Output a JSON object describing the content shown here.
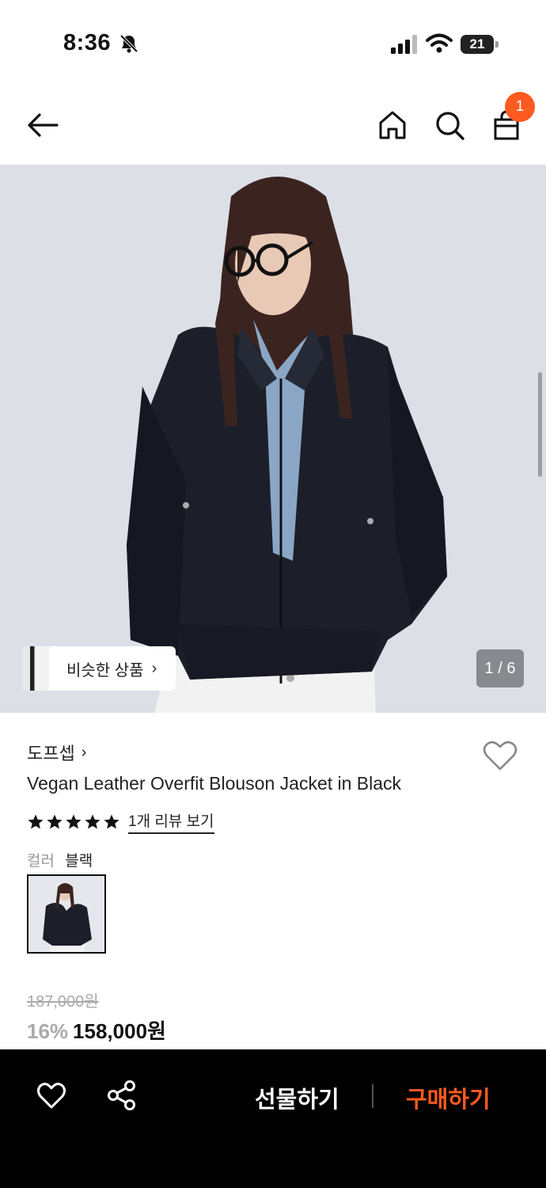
{
  "status_bar": {
    "time": "8:36",
    "battery": "21"
  },
  "nav": {
    "cart_count": "1"
  },
  "gallery": {
    "similar_label": "비슷한 상품",
    "page_counter": "1 / 6"
  },
  "product": {
    "brand": "도프셉",
    "title": "Vegan Leather Overfit Blouson Jacket in Black",
    "rating": 5,
    "review_link": "1개 리뷰 보기",
    "color_label": "컬러",
    "color_value": "블랙",
    "original_price": "187,000원",
    "discount": "16%",
    "price": "158,000원"
  },
  "bottom_bar": {
    "gift_label": "선물하기",
    "buy_label": "구매하기"
  },
  "colors": {
    "accent": "#ff5a1f",
    "bottom_bar_bg": "#000000",
    "image_bg": "#dcdfe6"
  }
}
